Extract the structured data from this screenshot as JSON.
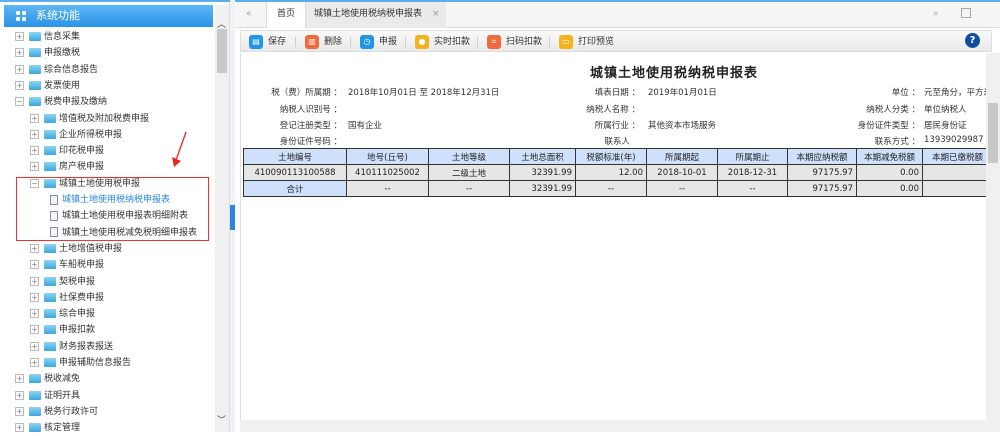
{
  "sidebar": {
    "title": "系统功能",
    "items": [
      {
        "label": "信息采集",
        "level": 0,
        "state": "collapsed"
      },
      {
        "label": "申报缴税",
        "level": 0,
        "state": "collapsed"
      },
      {
        "label": "综合信息报告",
        "level": 0,
        "state": "collapsed"
      },
      {
        "label": "发票使用",
        "level": 0,
        "state": "collapsed"
      },
      {
        "label": "税费申报及缴纳",
        "level": 0,
        "state": "expanded"
      },
      {
        "label": "增值税及附加税费申报",
        "level": 1,
        "state": "collapsed"
      },
      {
        "label": "企业所得税申报",
        "level": 1,
        "state": "collapsed"
      },
      {
        "label": "印花税申报",
        "level": 1,
        "state": "collapsed"
      },
      {
        "label": "房产税申报",
        "level": 1,
        "state": "collapsed"
      },
      {
        "label": "城镇土地使用税申报",
        "level": 1,
        "state": "expanded"
      },
      {
        "label": "城镇土地使用税纳税申报表",
        "level": 2,
        "state": "leaf",
        "active": true
      },
      {
        "label": "城镇土地使用税申报表明细附表",
        "level": 2,
        "state": "leaf"
      },
      {
        "label": "城镇土地使用税减免税明细申报表",
        "level": 2,
        "state": "leaf"
      },
      {
        "label": "土地增值税申报",
        "level": 1,
        "state": "collapsed"
      },
      {
        "label": "车船税申报",
        "level": 1,
        "state": "collapsed"
      },
      {
        "label": "契税申报",
        "level": 1,
        "state": "collapsed"
      },
      {
        "label": "社保费申报",
        "level": 1,
        "state": "collapsed"
      },
      {
        "label": "综合申报",
        "level": 1,
        "state": "collapsed"
      },
      {
        "label": "申报扣款",
        "level": 1,
        "state": "collapsed"
      },
      {
        "label": "财务报表报送",
        "level": 1,
        "state": "collapsed"
      },
      {
        "label": "申报辅助信息报告",
        "level": 1,
        "state": "collapsed"
      },
      {
        "label": "税收减免",
        "level": 0,
        "state": "collapsed"
      },
      {
        "label": "证明开具",
        "level": 0,
        "state": "collapsed"
      },
      {
        "label": "税务行政许可",
        "level": 0,
        "state": "collapsed"
      },
      {
        "label": "核定管理",
        "level": 0,
        "state": "collapsed"
      }
    ]
  },
  "tabs": {
    "back": "«",
    "home": "首页",
    "active": "城镇土地使用税纳税申报表",
    "close": "×",
    "forward": "»"
  },
  "toolbar": {
    "save": "保存",
    "delete": "删除",
    "declare": "申报",
    "realtime_deduct": "实时扣款",
    "scan_deduct": "扫码扣款",
    "print_preview": "打印预览",
    "help": "?"
  },
  "report": {
    "title": "城镇土地使用税纳税申报表",
    "fields": {
      "period_label": "税（费）所属期 ：",
      "period_value": "2018年10月01日 至 2018年12月31日",
      "fill_date_label": "填表日期 ：",
      "fill_date_value": "2019年01月01日",
      "unit_label": "单位 ：",
      "unit_value": "元至角分，平方米",
      "taxpayer_id_label": "纳税人识别号 ：",
      "taxpayer_name_label": "纳税人名称 ：",
      "taxpayer_class_label": "纳税人分类 ：",
      "taxpayer_class_value": "单位纳税人",
      "reg_type_label": "登记注册类型 ：",
      "reg_type_value": "国有企业",
      "industry_label": "所属行业 ：",
      "industry_value": "其他资本市场服务",
      "id_type_label": "身份证件类型 ：",
      "id_type_value": "居民身份证",
      "id_number_label": "身份证件号码 ：",
      "contact_label": "联系人",
      "phone_label": "联系方式 ：",
      "phone_value": "13939029987"
    },
    "columns": [
      "土地编号",
      "地号(丘号)",
      "土地等级",
      "土地总面积",
      "税额标准(年)",
      "所属期起",
      "所属期止",
      "本期应纳税额",
      "本期减免税额",
      "本期已缴税额"
    ],
    "rows": [
      [
        "410090113100588",
        "410111025002",
        "二级土地",
        "32391.99",
        "12.00",
        "2018-10-01",
        "2018-12-31",
        "97175.97",
        "0.00",
        ""
      ]
    ],
    "total": [
      "合计",
      "--",
      "--",
      "32391.99",
      "--",
      "--",
      "--",
      "97175.97",
      "0.00",
      ""
    ]
  }
}
